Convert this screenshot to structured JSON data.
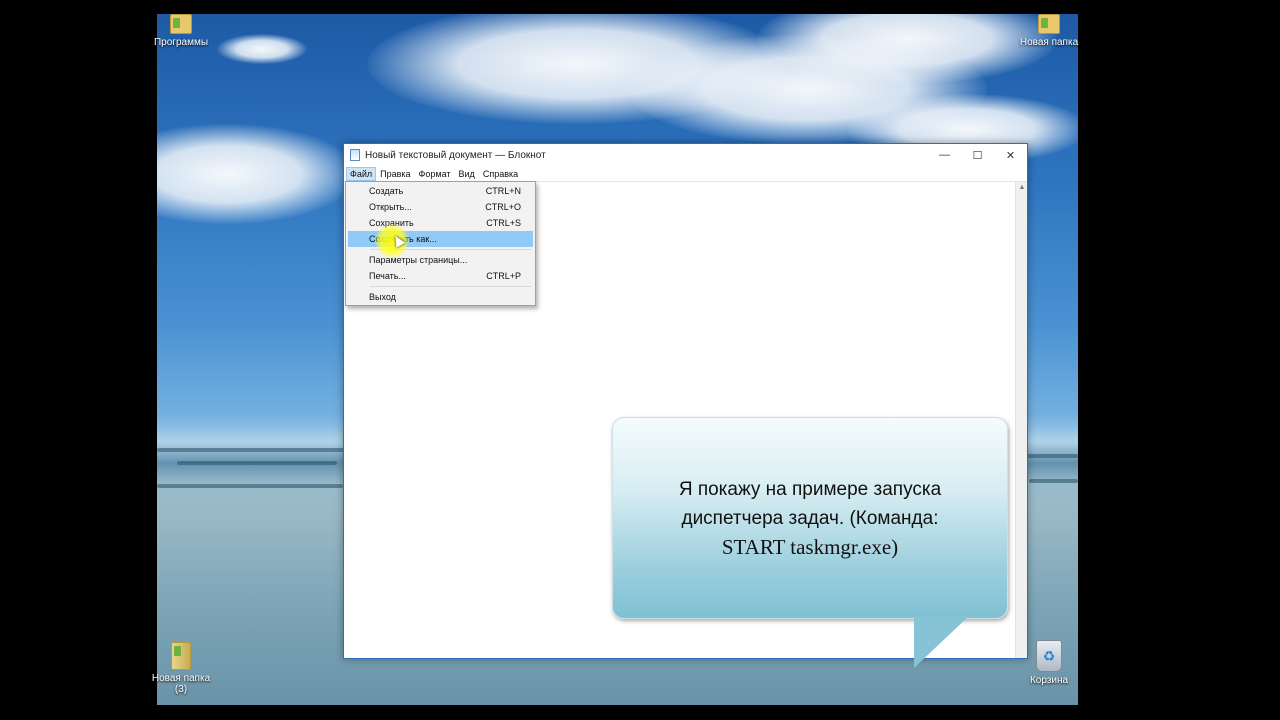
{
  "desktop": {
    "icons": {
      "top_left": "Программы",
      "top_right": "Новая папка",
      "bottom_left_line1": "Новая папка",
      "bottom_left_line2": "(3)",
      "bottom_right": "Корзина"
    }
  },
  "window": {
    "title": "Новый текстовый документ — Блокнот",
    "controls": {
      "minimize": "—",
      "maximize": "☐",
      "close": "✕"
    },
    "menu": [
      "Файл",
      "Правка",
      "Формат",
      "Вид",
      "Справка"
    ]
  },
  "file_menu": {
    "items": [
      {
        "label": "Создать",
        "shortcut": "CTRL+N"
      },
      {
        "label": "Открыть...",
        "shortcut": "CTRL+O"
      },
      {
        "label": "Сохранить",
        "shortcut": "CTRL+S"
      },
      {
        "label": "Сохранить как...",
        "shortcut": ""
      },
      {
        "label": "Параметры страницы...",
        "shortcut": ""
      },
      {
        "label": "Печать...",
        "shortcut": "CTRL+P"
      },
      {
        "label": "Выход",
        "shortcut": ""
      }
    ],
    "highlighted": "Сохранить как..."
  },
  "callout": {
    "line1": "Я покажу на примере запуска",
    "line2": "диспетчера задач. (Команда:",
    "line3": "START taskmgr.exe)"
  },
  "icons": [
    "folder-icon",
    "recycle-bin-icon",
    "notepad-icon"
  ]
}
